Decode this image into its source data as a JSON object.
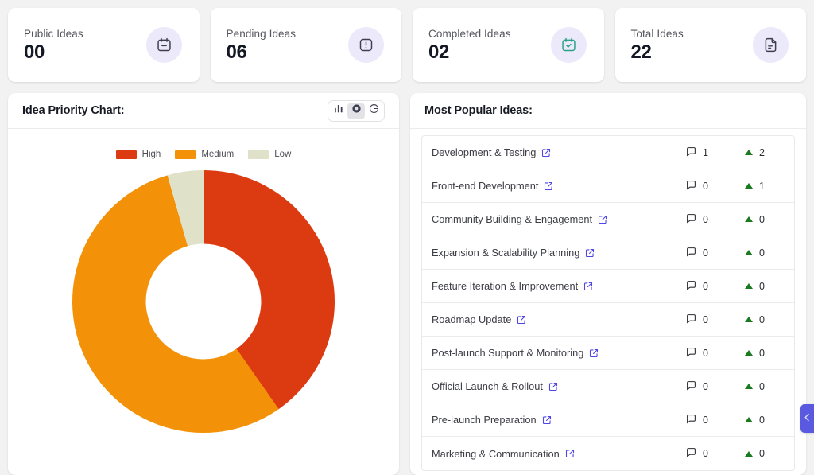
{
  "stats": [
    {
      "label": "Public Ideas",
      "value": "00",
      "icon": "calendar-minus-icon",
      "icon_color": "#3e3f52",
      "bubble_color": "#ece9fb"
    },
    {
      "label": "Pending Ideas",
      "value": "06",
      "icon": "alert-square-icon",
      "icon_color": "#3e3f52",
      "bubble_color": "#ece9fb"
    },
    {
      "label": "Completed Ideas",
      "value": "02",
      "icon": "calendar-check-icon",
      "icon_color": "#2aa284",
      "bubble_color": "#ece9fb"
    },
    {
      "label": "Total Ideas",
      "value": "22",
      "icon": "document-icon",
      "icon_color": "#3e3f52",
      "bubble_color": "#ece9fb"
    }
  ],
  "chart_panel": {
    "title": "Idea Priority Chart:",
    "toggles": [
      {
        "name": "bar-chart-view",
        "icon": "bar-chart-icon",
        "active": false
      },
      {
        "name": "donut-chart-view",
        "icon": "donut-chart-icon",
        "active": true
      },
      {
        "name": "pie-chart-view",
        "icon": "pie-chart-icon",
        "active": false
      }
    ]
  },
  "chart_data": {
    "type": "pie",
    "variant": "donut",
    "title": "Idea Priority Chart:",
    "categories": [
      "High",
      "Medium",
      "Low"
    ],
    "values": [
      9,
      12,
      1
    ],
    "percentages": [
      40.3,
      55.3,
      4.4
    ],
    "colors": [
      "#dc3a11",
      "#f39208",
      "#dfe2c9"
    ],
    "legend_position": "top",
    "legend": [
      {
        "label": "High",
        "color": "#dc3a11",
        "start_deg": 0,
        "end_deg": 145
      },
      {
        "label": "Medium",
        "color": "#f39208",
        "start_deg": 145,
        "end_deg": 344
      },
      {
        "label": "Low",
        "color": "#dfe2c9",
        "start_deg": 344,
        "end_deg": 360
      }
    ],
    "grid": false,
    "xlabel": "",
    "ylabel": ""
  },
  "ideas_panel": {
    "title": "Most Popular Ideas:",
    "rows": [
      {
        "title": "Development & Testing",
        "comments": "1",
        "votes": "2"
      },
      {
        "title": "Front-end Development",
        "comments": "0",
        "votes": "1"
      },
      {
        "title": "Community Building & Engagement",
        "comments": "0",
        "votes": "0"
      },
      {
        "title": "Expansion & Scalability Planning",
        "comments": "0",
        "votes": "0"
      },
      {
        "title": "Feature Iteration & Improvement",
        "comments": "0",
        "votes": "0"
      },
      {
        "title": "Roadmap Update",
        "comments": "0",
        "votes": "0"
      },
      {
        "title": "Post-launch Support & Monitoring",
        "comments": "0",
        "votes": "0"
      },
      {
        "title": "Official Launch & Rollout",
        "comments": "0",
        "votes": "0"
      },
      {
        "title": "Pre-launch Preparation",
        "comments": "0",
        "votes": "0"
      },
      {
        "title": "Marketing & Communication",
        "comments": "0",
        "votes": "0"
      }
    ]
  },
  "edge_tab": {
    "icon": "chevron-left-icon",
    "color": "#5a5ae0"
  },
  "theme": {
    "page_bg": "#f2f2f3",
    "card_bg": "#ffffff",
    "accent_indigo": "#5a5ae0",
    "link_icon_color": "#4f46e5",
    "vote_green": "#1a7a1f"
  }
}
